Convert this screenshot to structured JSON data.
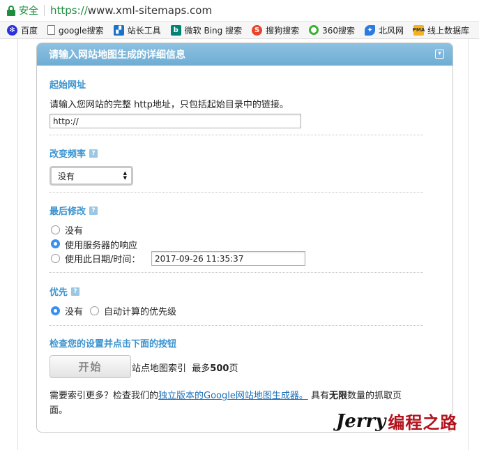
{
  "browser": {
    "secure_label": "安全",
    "url_scheme": "https://",
    "url_host": "www.xml-sitemaps.com"
  },
  "bookmarks": [
    {
      "label": "百度",
      "icon": "baidu-paw-icon"
    },
    {
      "label": "google搜索",
      "icon": "page-icon"
    },
    {
      "label": "站长工具",
      "icon": "chinaz-icon"
    },
    {
      "label": "微软 Bing 搜索",
      "icon": "bing-icon"
    },
    {
      "label": "搜狗搜索",
      "icon": "sogou-icon"
    },
    {
      "label": "360搜索",
      "icon": "360-icon"
    },
    {
      "label": "北风网",
      "icon": "beifeng-icon"
    },
    {
      "label": "线上数据库",
      "icon": "pma-icon"
    }
  ],
  "panel": {
    "title": "请输入网站地图生成的详细信息",
    "collapse_icon": "collapse-icon"
  },
  "start_url": {
    "label": "起始网址",
    "description": "请输入您网站的完整 http地址，只包括起始目录中的链接。",
    "value": "http://"
  },
  "change_freq": {
    "label": "改变频率",
    "help": "?",
    "selected": "没有"
  },
  "last_modified": {
    "label": "最后修改",
    "help": "?",
    "options": [
      "没有",
      "使用服务器的响应",
      "使用此日期/时间："
    ],
    "selected_index": 1,
    "date_value": "2017-09-26 11:35:37"
  },
  "priority": {
    "label": "优先",
    "help": "?",
    "options": [
      "没有",
      "自动计算的优先级"
    ],
    "selected_index": 0
  },
  "submit": {
    "label": "检查您的设置并点击下面的按钮",
    "button": "开始",
    "index_text": "站点地图索引",
    "max_prefix": "最多",
    "max_number": "500",
    "max_suffix": "页"
  },
  "footer": {
    "prefix": "需要索引更多？检查我们的",
    "link": "独立版本的Google网站地图生成器。",
    "mid": "具有",
    "bold": "无限",
    "suffix_line1": "数量的抓取页",
    "suffix_line2": "面。"
  },
  "watermark": {
    "latin": "Jerry",
    "chinese": "编程之路"
  }
}
